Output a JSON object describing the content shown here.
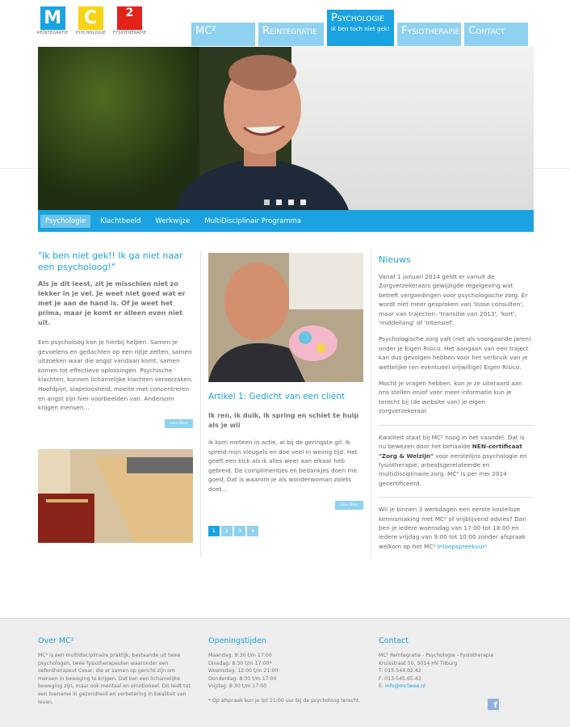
{
  "logo": {
    "items": [
      {
        "letter": "M",
        "sub": "REÏNTEGRATIE",
        "color": "#1aa3e0"
      },
      {
        "letter": "C",
        "sub": "PSYCHOLOGIE",
        "color": "#f7d417"
      },
      {
        "letter": "2",
        "sub": "FYSIOTHERAPIE",
        "color": "#e2231a"
      }
    ]
  },
  "nav": {
    "items": [
      {
        "label": "MC²"
      },
      {
        "label": "Reïntegratie"
      },
      {
        "label": "Psychologie",
        "sub": "Ik ben toch niet gek!"
      },
      {
        "label": "Fysiotherapie"
      },
      {
        "label": "Contact"
      }
    ]
  },
  "subnav": {
    "items": [
      "Psychologie",
      "Klachtbeeld",
      "Werkwijze",
      "MultiDisciplinair Programma"
    ]
  },
  "col1": {
    "title": "\"Ik ben niet gek!! Ik ga niet naar een psycholoog!\"",
    "lead": "Als je dit leest, zit je misschien niet zo lekker in je vel. Je weet niet goed wat er met je aan de hand is. Of je weet het prima, maar je komt er alleen even niet uit.",
    "body": "Een psycholoog kan je hierbij helpen. Samen je gevoelens en gedachten op een rijtje zetten, samen uitzoeken waar die angst vandaan komt, samen komen tot effectieve oplossingen. Psychische klachten, kunnen lichamelijke klachten veroorzaken. Hoofdpijn, slapeloosheid, moeite met concentreren en angst zijn hier voorbeelden van. Andersom krijgen mensen…",
    "readmore": "Lees Meer"
  },
  "col2": {
    "title": "Artikel 1: Gedicht van een cliënt",
    "lead": "Ik ren, ik duik, ik spring en schiet te hulp als je wil",
    "body": "ik kom meteen in actie, al bij de geringste gil. Ik spreid mijn vleugels en doe veel in weinig tijd. Het geeft een kick als ik alles weer aan elkaar heb gebreid. De complimentjes en bedankjes doen me goed, Dat is waarom je als wonderwoman zoiets doet…",
    "readmore": "Lees Meer",
    "pages": [
      "1",
      "2",
      "3",
      "4"
    ]
  },
  "col3": {
    "title": "Nieuws",
    "p1": "Vanaf 1 januari 2014 geldt er vanuit de Zorgverzekeraars gewijzigde regelgeving wat betreft vergoedingen voor psychologische zorg. Er wordt niet meer gesproken van 'losse consulten', maar van trajecten: 'transitie van 2013', 'kort', 'middellang' of 'intensief'.",
    "p2": "Psychologische zorg valt (net als voorgaande jaren) onder je Eigen Risico. Het aangaan van een traject kan dus gevolgen hebben voor het verbruik van je wettelijke (en eventueel vrijwillige) Eigen Risico.",
    "p3": "Mocht je vragen hebben, kun je ze uiteraard aan ons stellen en/of voor meer informatie kun je terecht bij (de website van) je eigen zorgverzekeraar.",
    "p4a": "Kwaliteit staat bij MC² hoog in het vaandel. Dat is nu bewezen door het behaalde ",
    "p4b": "NEN-certificaat \"Zorg & Welzijn\"",
    "p4c": " voor eerstelijns psychologie en fysiotherapie, arbeidsgerelateerde en multidisciplinaire zorg. MC² is per mei 2014 gecertificeerd.",
    "p5": "Wil je binnen 3 werkdagen een eerste kosteloze kennismaking met MC² of vrijblijvend advies? Dan ben je iedere woensdag van 17:00 tot 18:00 en iedere vrijdag van 9:00 tot 10:00 zonder afspraak welkom op het MC²",
    "p5link": "Inloopspreekuur!"
  },
  "footer": {
    "about_title": "Over MC²",
    "about_text": "MC² is een multidisciplinaire praktijk, bestaande uit twee psychologen, twee fysiotherapeuten waaronder een oefentherapeut Cesar, die er samen op gericht zijn om mensen in beweging te krijgen. Dat kan een lichamelijke beweging zijn, maar ook mentaal en emotioneel. Dit leidt tot een toename in gezondheid en verbetering in kwaliteit van leven.",
    "hours_title": "Openingstijden",
    "hours": [
      "Maandag: 8:30 t/m 17:00",
      "Dinsdag: 8:30 t/m 17:00*",
      "Woensdag: 12:00 t/m 21:00",
      "Donderdag: 8:30 t/m 17:00",
      "Vrijdag: 8:30 t/m 17:00"
    ],
    "hours_note": "* Op afspraak kun je tot 21:00 uur bij de psycholoog terecht.",
    "contact_title": "Contact",
    "contact_lines": [
      "MC² Reïntegratie - Psychologie - Fysiotherapie",
      "Kruisstraat 50, 5014 HV Tilburg",
      "T: 013-544.02.42",
      "F: 013-545.65.43"
    ],
    "email_label": "E: ",
    "email": "info@mctwee.nl",
    "facebook": "f"
  }
}
